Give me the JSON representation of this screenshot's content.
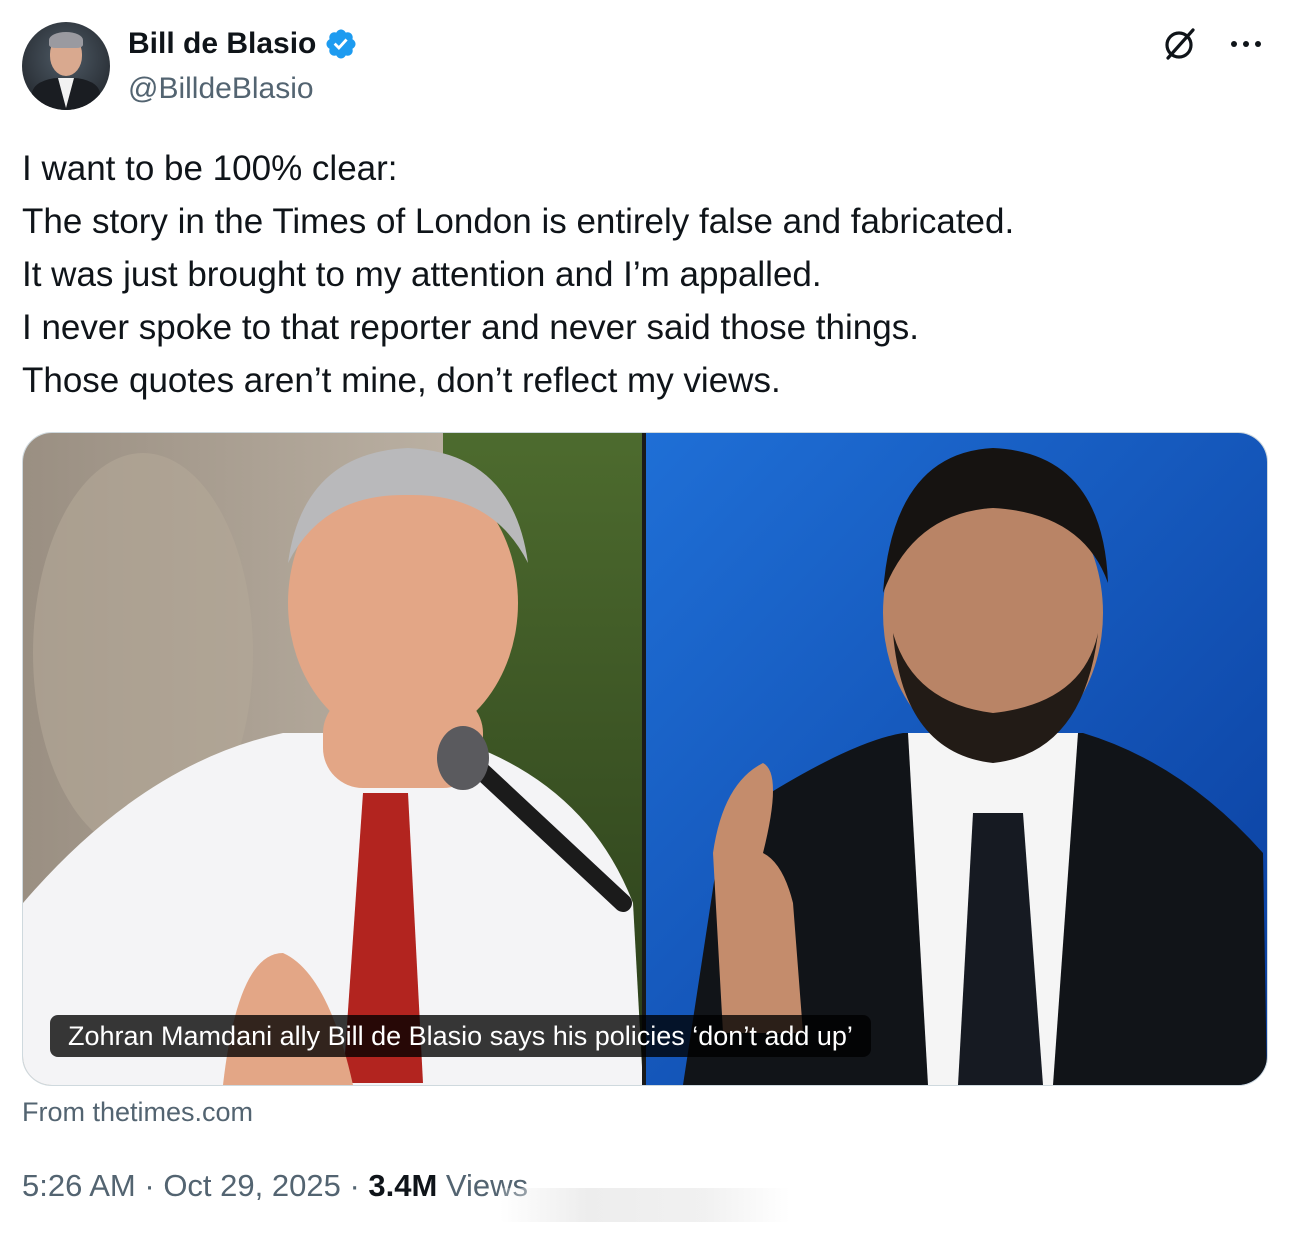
{
  "author": {
    "name": "Bill de Blasio",
    "handle": "@BilldeBlasio",
    "verified": true
  },
  "icons": {
    "verified": "verified-badge-icon",
    "grok": "grok-icon",
    "more": "more-icon"
  },
  "tweet": {
    "lines": [
      "I want to be 100% clear:",
      "The story in the Times of London is entirely false and fabricated.",
      "It was just brought to my attention and I’m appalled.",
      "I never spoke to that reporter and never said those things.",
      "Those quotes aren’t mine, don’t reflect my views."
    ]
  },
  "card": {
    "caption": "Zohran Mamdani ally Bill de Blasio says his policies ‘don’t add up’",
    "source": "From thetimes.com"
  },
  "meta": {
    "time": "5:26 AM",
    "date": "Oct 29, 2025",
    "separator": " · ",
    "views_count": "3.4M",
    "views_label": " Views"
  },
  "colors": {
    "text": "#0f1419",
    "secondary": "#536471",
    "verified_blue": "#1d9bf0",
    "border": "#cfd9de"
  }
}
